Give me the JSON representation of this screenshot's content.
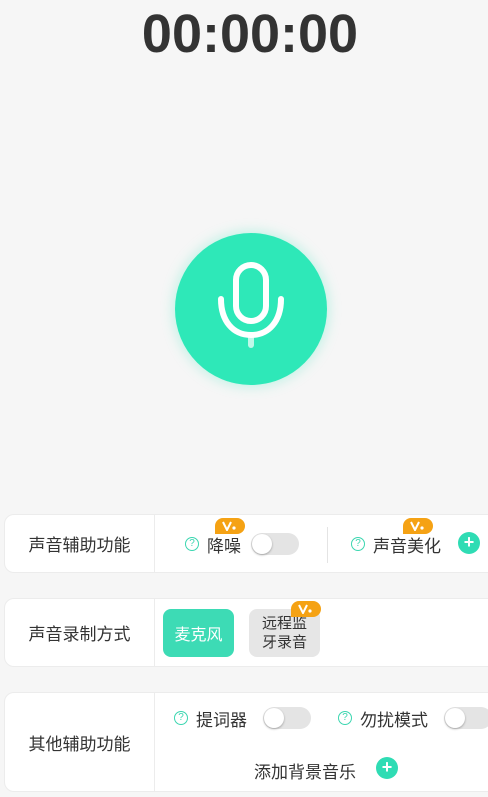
{
  "timer": "00:00:00",
  "record_button": {
    "icon": "microphone-icon",
    "color": "#2ee8b8"
  },
  "assist_card": {
    "label": "声音辅助功能",
    "noise_reduction": {
      "label": "降噪",
      "enabled": false,
      "vip": true
    },
    "voice_beautify": {
      "label": "声音美化",
      "vip": true
    }
  },
  "record_mode_card": {
    "label": "声音录制方式",
    "options": [
      {
        "label": "麦克风",
        "selected": true
      },
      {
        "label_line1": "远程监",
        "label_line2": "牙录音",
        "selected": false,
        "vip": true
      }
    ]
  },
  "other_card": {
    "label": "其他辅助功能",
    "teleprompter": {
      "label": "提词器",
      "enabled": false
    },
    "do_not_disturb": {
      "label": "勿扰模式",
      "enabled": false
    },
    "background_music": {
      "label": "添加背景音乐"
    }
  },
  "colors": {
    "accent": "#2ee8b8",
    "vip": "#f5a214"
  }
}
